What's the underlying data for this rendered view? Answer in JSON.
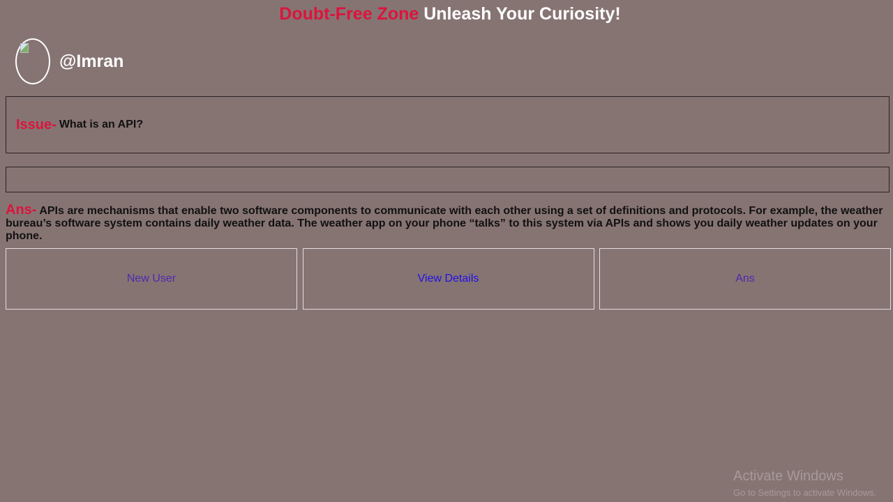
{
  "header": {
    "brand": "Doubt-Free Zone",
    "tagline": "Unleash Your Curiosity!"
  },
  "user": {
    "username": "@Imran"
  },
  "issue": {
    "label": "Issue-",
    "text": "What is an API?"
  },
  "answer": {
    "label": "Ans-",
    "text": "APIs are mechanisms that enable two software components to communicate with each other using a set of definitions and protocols. For example, the weather bureau’s software system contains daily weather data. The weather app on your phone “talks” to this system via APIs and shows you daily weather updates on your phone."
  },
  "buttons": [
    {
      "label": "New User",
      "state": "visited"
    },
    {
      "label": "View Details",
      "state": "link"
    },
    {
      "label": "Ans",
      "state": "visited"
    }
  ],
  "colors": {
    "background": "#867473",
    "accent": "#dc143c",
    "visited_link": "#4b2ab0",
    "link": "#1f10e8"
  },
  "watermark": {
    "title": "Activate Windows",
    "subtitle": "Go to Settings to activate Windows."
  }
}
